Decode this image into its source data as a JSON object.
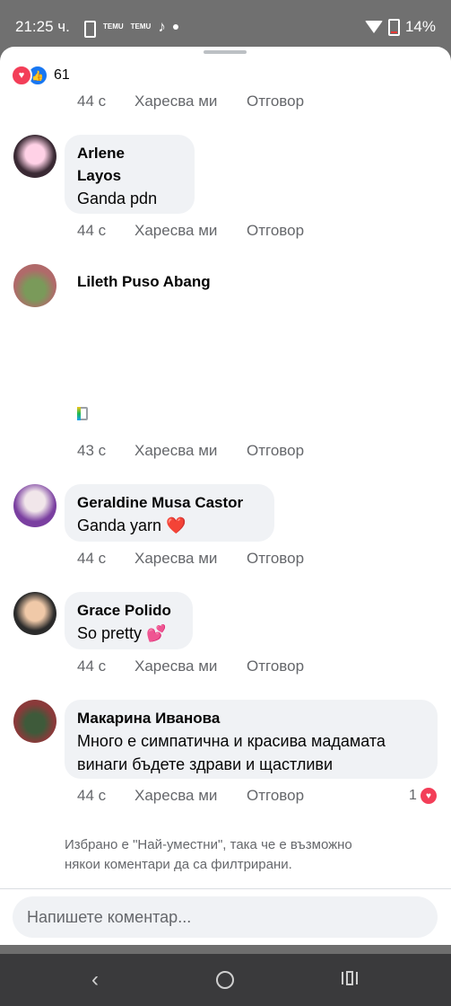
{
  "status_bar": {
    "time": "21:25 ч.",
    "temu_label": "TEMU",
    "battery_pct": "14%"
  },
  "reactions": {
    "count": "61"
  },
  "comments": [
    {
      "time": "44 с",
      "like": "Харесва ми",
      "reply": "Отговор"
    },
    {
      "name_line1": "Arlene",
      "name_line2": "Layos",
      "text": "Ganda pdn",
      "time": "44 с",
      "like": "Харесва ми",
      "reply": "Отговор"
    },
    {
      "name": "Lileth Puso Abang",
      "time": "43 с",
      "like": "Харесва ми",
      "reply": "Отговор"
    },
    {
      "name": "Geraldine Musa Castor",
      "text": "Ganda yarn ❤️",
      "time": "44 с",
      "like": "Харесва ми",
      "reply": "Отговор"
    },
    {
      "name": "Grace Polido",
      "text": "So pretty 💕",
      "time": "44 с",
      "like": "Харесва ми",
      "reply": "Отговор"
    },
    {
      "name": "Макарина Иванова",
      "text_line1": "Много е симпатична и красива мадамата",
      "text_line2": "винаги бъдете здрави и щастливи",
      "time": "44 с",
      "like": "Харесва ми",
      "reply": "Отговор",
      "reaction_count": "1"
    }
  ],
  "notice_line1": "Избрано е \"Най-уместни\", така че е възможно",
  "notice_line2": "някои коментари да са филтрирани.",
  "composer": {
    "placeholder": "Напишете коментар..."
  },
  "icons": [
    "heart-reaction-icon",
    "like-reaction-icon",
    "wifi-icon",
    "battery-icon",
    "back-icon",
    "home-icon",
    "recents-icon"
  ],
  "colors": {
    "heart": "#f33e58",
    "like": "#1877f2",
    "bubble": "#f0f2f5",
    "secondary_text": "#65676b"
  }
}
